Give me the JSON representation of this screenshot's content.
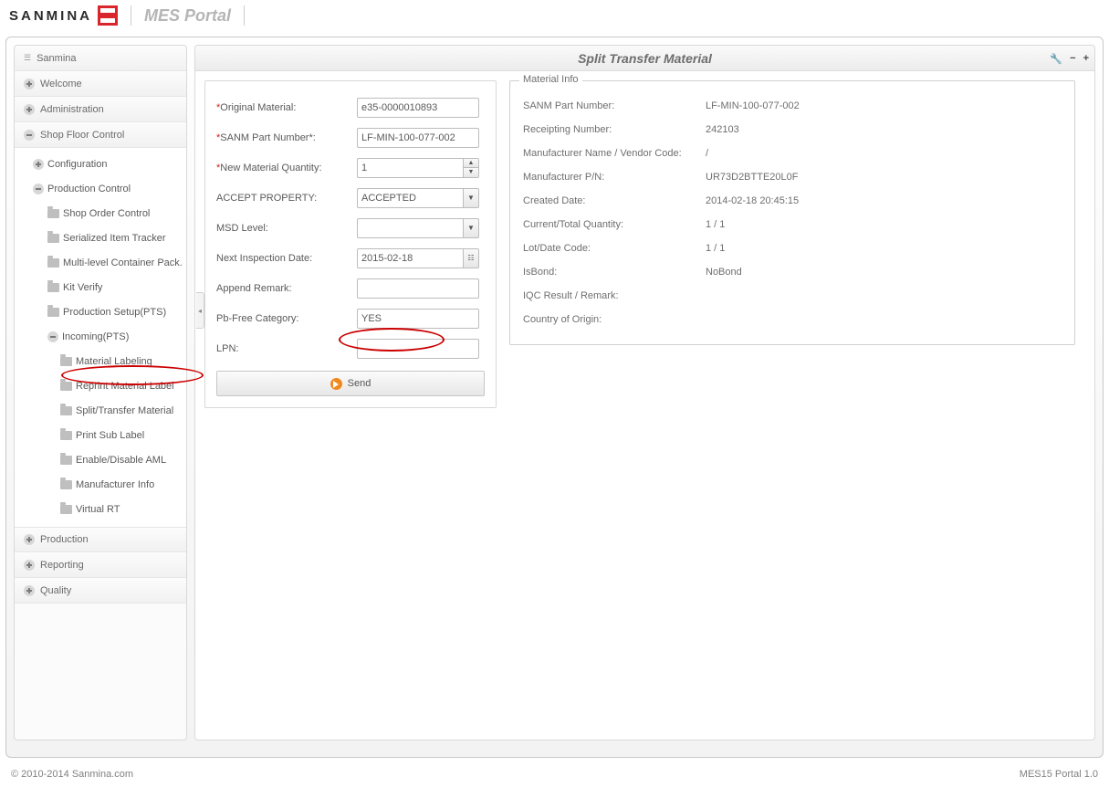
{
  "brand_name": "SANMINA",
  "portal_title": "MES Portal",
  "footer_left": "© 2010-2014 Sanmina.com",
  "footer_right": "MES15 Portal 1.0",
  "sidebar": {
    "root": "Sanmina",
    "items": [
      {
        "label": "Welcome",
        "expanded": false
      },
      {
        "label": "Administration",
        "expanded": false
      },
      {
        "label": "Shop Floor Control",
        "expanded": true
      },
      {
        "label": "Production",
        "expanded": false
      },
      {
        "label": "Reporting",
        "expanded": false
      },
      {
        "label": "Quality",
        "expanded": false
      }
    ],
    "sfc": {
      "configuration": "Configuration",
      "production_control": "Production Control",
      "pc_children": [
        "Shop Order Control",
        "Serialized Item Tracker",
        "Multi-level Container Pack.",
        "Kit Verify",
        "Production Setup(PTS)"
      ],
      "incoming": "Incoming(PTS)",
      "incoming_children": [
        "Material Labeling",
        "Reprint Material Label",
        "Split/Transfer Material",
        "Print Sub Label",
        "Enable/Disable AML",
        "Manufacturer Info",
        "Virtual RT"
      ]
    }
  },
  "panel": {
    "title": "Split Transfer Material",
    "form": {
      "original_material": {
        "label": "Original Material:",
        "value": "e35-0000010893",
        "required": true
      },
      "sanm_part": {
        "label": "SANM Part Number*:",
        "value": "LF-MIN-100-077-002",
        "required": true
      },
      "new_qty": {
        "label": "New Material Quantity:",
        "value": "1",
        "required": true
      },
      "accept_property": {
        "label": "ACCEPT PROPERTY:",
        "value": "ACCEPTED"
      },
      "msd_level": {
        "label": "MSD Level:",
        "value": ""
      },
      "next_inspection": {
        "label": "Next Inspection Date:",
        "value": "2015-02-18"
      },
      "append_remark": {
        "label": "Append Remark:",
        "value": ""
      },
      "pb_free": {
        "label": "Pb-Free Category:",
        "value": "YES"
      },
      "lpn": {
        "label": "LPN:",
        "value": ""
      },
      "send": "Send"
    },
    "info": {
      "legend": "Material Info",
      "rows": [
        {
          "label": "SANM Part Number:",
          "value": "LF-MIN-100-077-002"
        },
        {
          "label": "Receipting Number:",
          "value": "242103"
        },
        {
          "label": "Manufacturer Name / Vendor Code:",
          "value": "/"
        },
        {
          "label": "Manufacturer P/N:",
          "value": "UR73D2BTTE20L0F"
        },
        {
          "label": "Created Date:",
          "value": "2014-02-18 20:45:15"
        },
        {
          "label": "Current/Total Quantity:",
          "value": "1 / 1"
        },
        {
          "label": "Lot/Date Code:",
          "value": "1 / 1"
        },
        {
          "label": "IsBond:",
          "value": "NoBond"
        },
        {
          "label": "IQC Result / Remark:",
          "value": ""
        },
        {
          "label": "Country of Origin:",
          "value": ""
        }
      ]
    }
  }
}
